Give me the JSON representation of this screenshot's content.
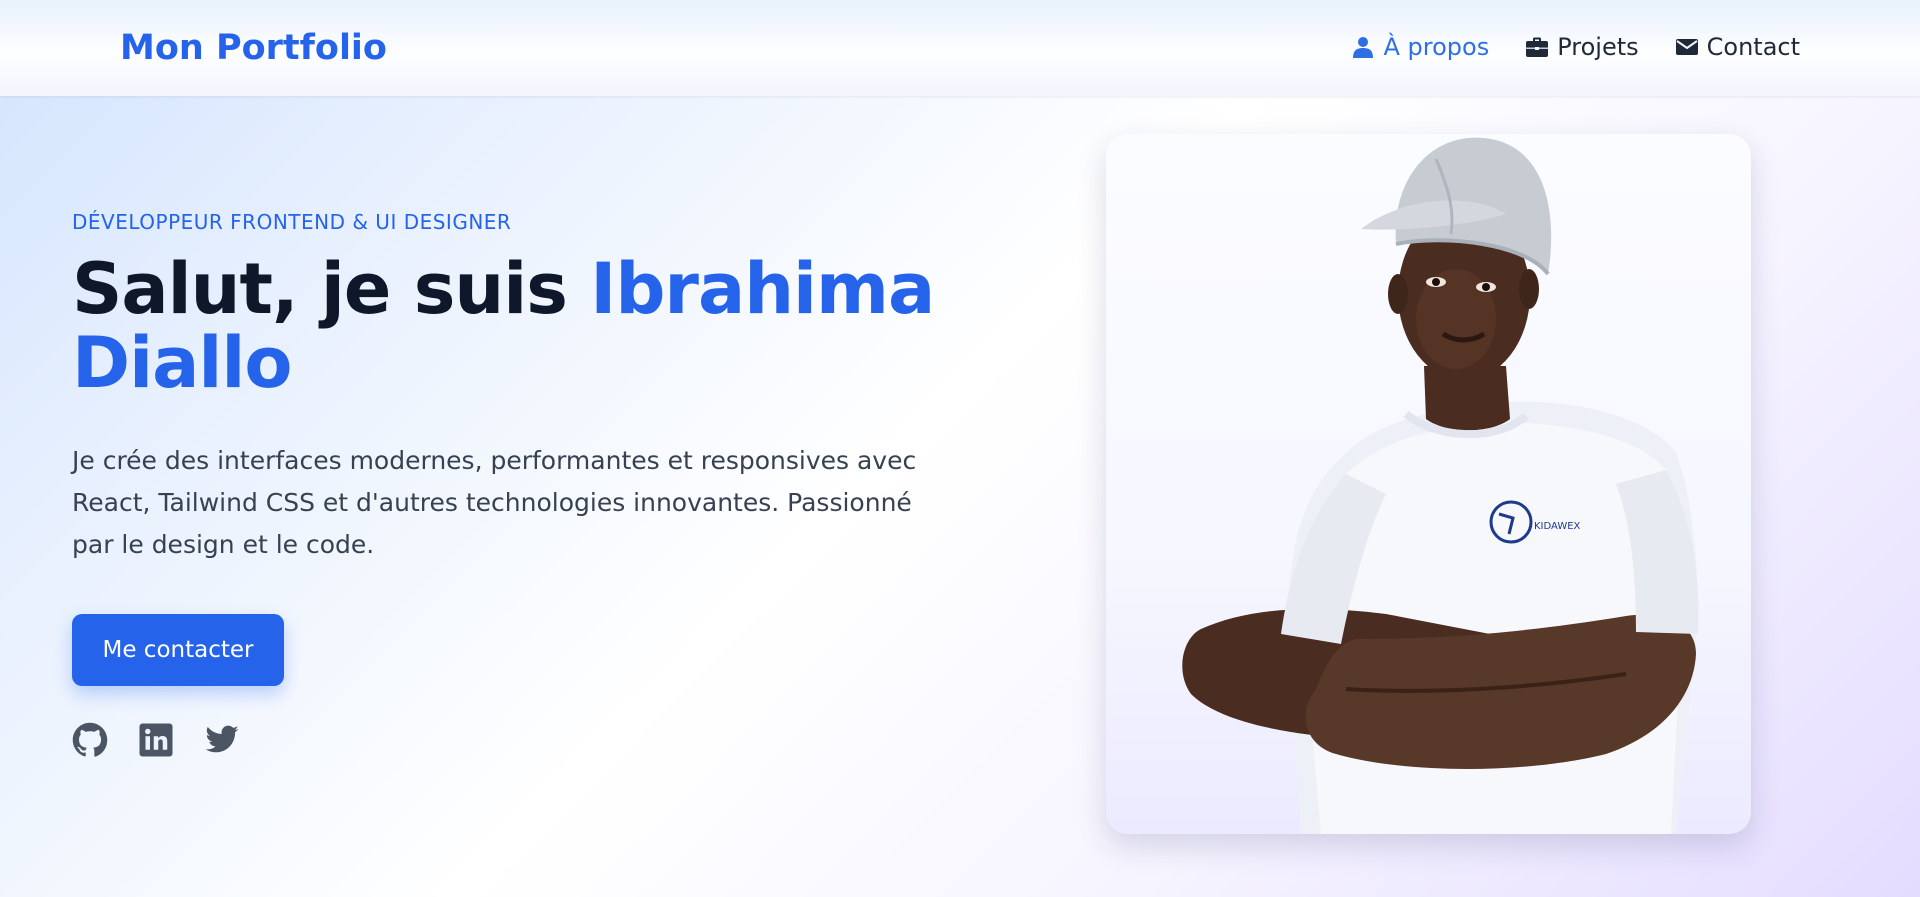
{
  "header": {
    "logo": "Mon Portfolio",
    "nav": [
      {
        "label": "À propos",
        "icon": "user-icon",
        "active": true
      },
      {
        "label": "Projets",
        "icon": "briefcase-icon",
        "active": false
      },
      {
        "label": "Contact",
        "icon": "envelope-icon",
        "active": false
      }
    ]
  },
  "hero": {
    "subtitle": "DÉVELOPPEUR FRONTEND & UI DESIGNER",
    "headline_prefix": "Salut, je suis ",
    "headline_name": "Ibrahima Diallo",
    "description": "Je crée des interfaces modernes, performantes et responsives avec React, Tailwind CSS et d'autres technologies innovantes. Passionné par le design et le code.",
    "cta_label": "Me contacter",
    "socials": [
      "github-icon",
      "linkedin-icon",
      "twitter-icon"
    ]
  },
  "colors": {
    "accent": "#2563eb",
    "text_dark": "#0f172a",
    "text_body": "#374151",
    "nav_text": "#1f2937"
  }
}
